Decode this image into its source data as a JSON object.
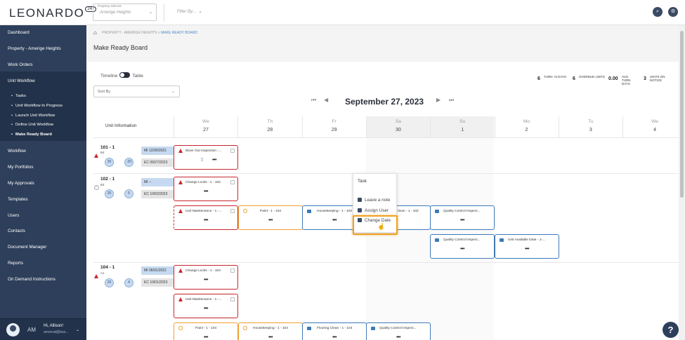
{
  "app": {
    "logo": "LEONARDO",
    "logo_badge": "247"
  },
  "header": {
    "property_selector_label": "Property selector",
    "property_selector_value": "Amerige Heights",
    "filter_by": "Filter By..."
  },
  "sidebar": {
    "items": [
      "Dashboard",
      "Property - Amerige Heights",
      "Work Orders",
      "Unit Workflow",
      "Workflow",
      "My Portfolios",
      "My Approvals",
      "Templates",
      "Users",
      "Contacts",
      "Document Manager",
      "Reports",
      "On Demand Instructions"
    ],
    "subitems": [
      "Tasks",
      "Unit Workflow In Progress",
      "Launch Unit Workflow",
      "Define Unit Workflow",
      "Make Ready Board"
    ],
    "user_initials": "AM",
    "user_greeting": "Hi, Allison!",
    "user_email": "amorcat@bas..."
  },
  "breadcrumb": {
    "parent": "PROPERTY - AMERIGE HEIGHTS",
    "sep": ">",
    "current": "MAKE READY BOARD"
  },
  "page_title": "Make Ready Board",
  "view_toggle": {
    "left": "Timeline",
    "right": "Table"
  },
  "sort_by": "Sort By",
  "stats": [
    {
      "value": "6",
      "label": "TURN +5 DAYS"
    },
    {
      "value": "6",
      "label": "OVERDUE UNITS"
    },
    {
      "value": "0.00",
      "label": "AVG. TURN DAYS"
    },
    {
      "value": "3",
      "label": "UNITS ON NOTICE"
    }
  ],
  "date_title": "September 27, 2023",
  "unit_info_header": "Unit Information",
  "days": [
    {
      "name": "We",
      "num": "27"
    },
    {
      "name": "Th",
      "num": "28"
    },
    {
      "name": "Fr",
      "num": "29"
    },
    {
      "name": "Sa",
      "num": "30"
    },
    {
      "name": "Su",
      "num": "1"
    },
    {
      "name": "Mo",
      "num": "2"
    },
    {
      "name": "Tu",
      "num": "3"
    },
    {
      "name": "We",
      "num": "4"
    }
  ],
  "units": [
    {
      "name": "101 - 1",
      "sub": "B4",
      "c1": "20",
      "c2": "-20",
      "mi": "MI 12/30/2021",
      "ec": "EC 09/27/2023"
    },
    {
      "name": "102 - 1",
      "sub": "B4",
      "c1": "20",
      "c2": "5",
      "mi": "MI --",
      "ec": "EC 10/02/2023"
    },
    {
      "name": "104 - 1",
      "sub": "A1",
      "c1": "20",
      "c2": "4",
      "mi": "MI 06/01/2021",
      "ec": "EC 10/01/2023"
    }
  ],
  "cards": {
    "move_out": "Move Out Inspection -...",
    "change_locks_102": "Change Locks - 1 - 102",
    "unit_maint_102": "Unit Maintenance - 1 -...",
    "paint_102": "Paint - 1 - 102",
    "housekeeping_102": "Housekeeping - 1 - 102",
    "flooring_102": "Clean - 1 - 102",
    "qc_102": "Quality Control Inspect...",
    "qc_102b": "Quality Control Inspect...",
    "unit_avail_102": "Unit Available Date - 1-...",
    "change_locks_104": "Change Locks - 1 - 104",
    "unit_maint_104": "Unit Maintenance - 1 -...",
    "paint_104": "Paint - 1 - 104",
    "housekeeping_104": "Housekeeping - 1 - 104",
    "flooring_104": "Flooring Clean - 1 - 104",
    "qc_104": "Quality Control Inspect...",
    "dots": "•••"
  },
  "context_menu": {
    "header": "Task",
    "items": [
      "Leave a note",
      "Assign User",
      "Change Date"
    ]
  },
  "colors": {
    "sidebar": "#2d3f5a",
    "accent_blue": "#3d7ab8",
    "alert_red": "#c7262e",
    "warning_orange": "#f0a030",
    "highlight": "#f0a020"
  }
}
